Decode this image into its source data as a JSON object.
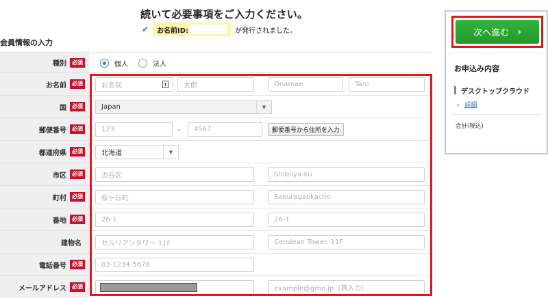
{
  "header": {
    "heading": "続いて必要事項をご入力ください。",
    "id_label": "お名前ID:",
    "issued_suffix": "が発行されました。"
  },
  "section_title": "会員情報の入力",
  "required_badge": "必須",
  "form": {
    "type": {
      "label": "種別",
      "options": [
        "個人",
        "法人"
      ],
      "selected": "個人"
    },
    "name": {
      "label": "お名前",
      "last_placeholder": "お名前",
      "first_placeholder": "太郎",
      "last_roman_placeholder": "Onamae",
      "first_roman_placeholder": "Taro"
    },
    "country": {
      "label": "国",
      "value": "Japan"
    },
    "postal": {
      "label": "郵便番号",
      "part1_placeholder": "123",
      "dash": "-",
      "part2_placeholder": "4567",
      "lookup_button": "郵便番号から住所を入力"
    },
    "prefecture": {
      "label": "都道府県",
      "value": "北海道"
    },
    "city": {
      "label": "市区",
      "placeholder": "渋谷区",
      "roman_placeholder": "Shibuya-ku"
    },
    "town": {
      "label": "町村",
      "placeholder": "桜ヶ丘町",
      "roman_placeholder": "Sakuragaokacho"
    },
    "street": {
      "label": "番地",
      "placeholder": "26-1",
      "roman_placeholder": "26-1"
    },
    "building": {
      "label": "建物名",
      "placeholder": "セルリアンタワー 11F",
      "roman_placeholder": "Cerulean Tower. 11F"
    },
    "phone": {
      "label": "電話番号",
      "placeholder": "03-1234-5678"
    },
    "email": {
      "label": "メールアドレス",
      "confirm_placeholder": "example@gmo.jp（再入力）"
    }
  },
  "sidebar": {
    "next_button": "次へ進む",
    "summary_title": "お申込み内容",
    "plan_name": "デスクトップクラウド",
    "details_link": "詳細",
    "total_label": "合計(税込)"
  },
  "icons": {
    "check": "check-icon",
    "name_card": "card-icon",
    "select_arrow": "caret-down-icon",
    "next_arrow": "chevron-right-icon",
    "details_chevron": "chevron-down-icon"
  },
  "colors": {
    "required_badge": "#c8102e",
    "next_button": "#2aa632",
    "highlight_frame": "#e8141a",
    "link": "#3670b8",
    "id_highlight": "#fff6a6"
  }
}
